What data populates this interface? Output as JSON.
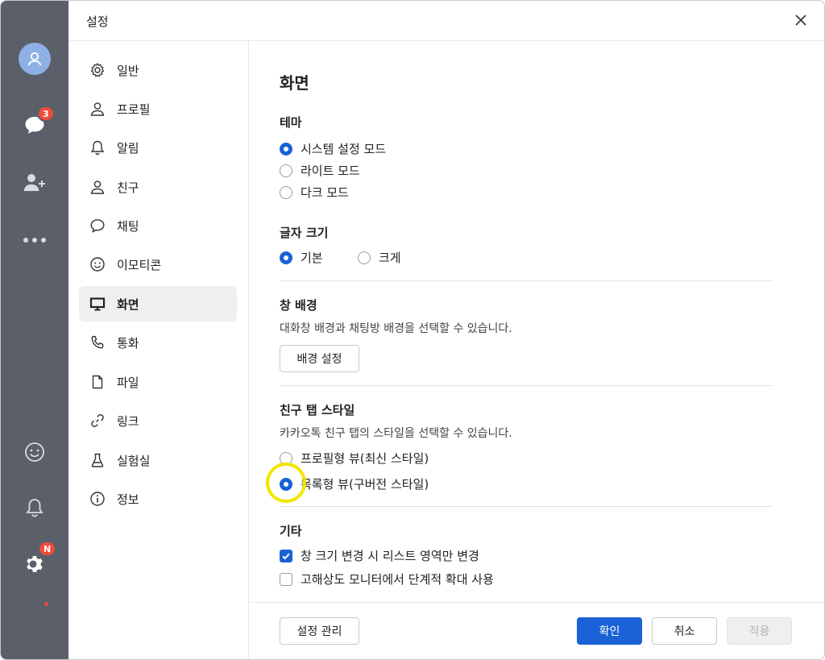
{
  "window": {
    "title": "설정"
  },
  "rail": {
    "chat_badge": "3",
    "settings_badge": "N"
  },
  "nav": {
    "items": [
      {
        "label": "일반",
        "icon": "gear-icon"
      },
      {
        "label": "프로필",
        "icon": "person-icon"
      },
      {
        "label": "알림",
        "icon": "bell-icon"
      },
      {
        "label": "친구",
        "icon": "person-icon"
      },
      {
        "label": "채팅",
        "icon": "speech-bubble-icon"
      },
      {
        "label": "이모티콘",
        "icon": "smiley-icon"
      },
      {
        "label": "화면",
        "icon": "monitor-icon",
        "active": true
      },
      {
        "label": "통화",
        "icon": "phone-icon"
      },
      {
        "label": "파일",
        "icon": "file-icon"
      },
      {
        "label": "링크",
        "icon": "link-icon"
      },
      {
        "label": "실험실",
        "icon": "flask-icon"
      },
      {
        "label": "정보",
        "icon": "info-icon"
      }
    ]
  },
  "main": {
    "heading": "화면",
    "theme": {
      "title": "테마",
      "options": [
        "시스템 설정 모드",
        "라이트 모드",
        "다크 모드"
      ],
      "selected": "시스템 설정 모드"
    },
    "font_size": {
      "title": "글자 크기",
      "options": [
        "기본",
        "크게"
      ],
      "selected": "기본"
    },
    "background": {
      "title": "창 배경",
      "description": "대화창 배경과 채팅방 배경을 선택할 수 있습니다.",
      "button": "배경 설정"
    },
    "friend_tab": {
      "title": "친구 탭 스타일",
      "description": "카카오톡 친구 탭의 스타일을 선택할 수 있습니다.",
      "options": [
        "프로필형 뷰(최신 스타일)",
        "목록형 뷰(구버전 스타일)"
      ],
      "selected": "목록형 뷰(구버전 스타일)"
    },
    "etc": {
      "title": "기타",
      "checkboxes": [
        {
          "label": "창 크기 변경 시 리스트 영역만 변경",
          "checked": true
        },
        {
          "label": "고해상도 모니터에서 단계적 확대 사용",
          "checked": false
        }
      ]
    }
  },
  "footer": {
    "manage_label": "설정 관리",
    "confirm_label": "확인",
    "cancel_label": "취소",
    "apply_label": "적용"
  },
  "colors": {
    "accent": "#1a62d6",
    "rail": "#5a5f69",
    "badge": "#ef4c3a",
    "highlight": "#f2e600"
  }
}
